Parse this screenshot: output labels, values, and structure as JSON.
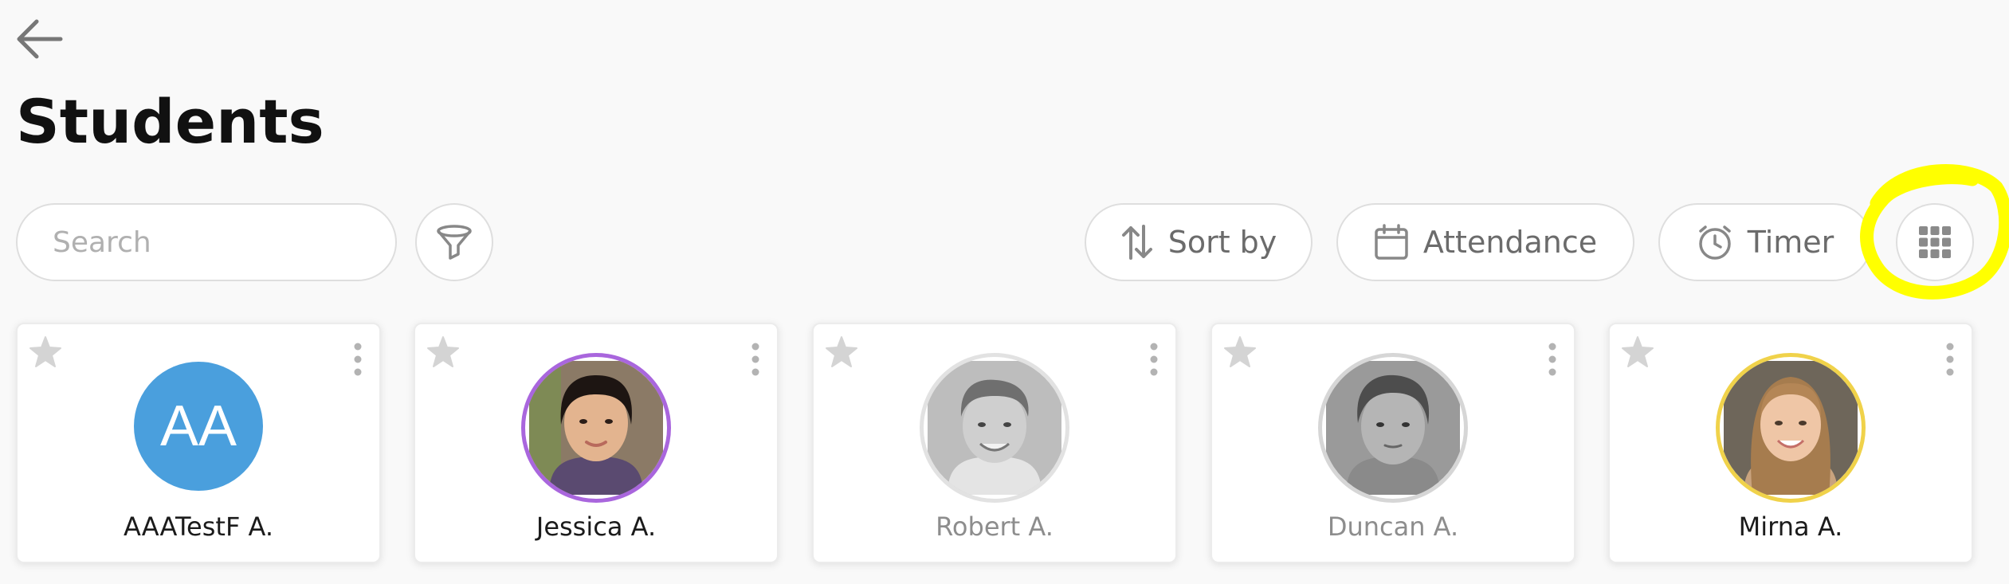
{
  "header": {
    "back_icon": "arrow-left-icon",
    "title": "Students"
  },
  "toolbar": {
    "search_placeholder": "Search",
    "filter_icon": "funnel-icon",
    "sort_label": "Sort by",
    "attendance_label": "Attendance",
    "timer_label": "Timer",
    "grid_icon": "grid-view-icon"
  },
  "colors": {
    "highlight": "#ffff00",
    "initials_avatar": "#4a9fdd",
    "ring_purple": "#a966dd",
    "ring_gold": "#f0d24a",
    "ring_gray": "#d6d6d6"
  },
  "students": [
    {
      "name": "AAATestF A.",
      "initials": "AA"
    },
    {
      "name": "Jessica A."
    },
    {
      "name": "Robert A."
    },
    {
      "name": "Duncan A."
    },
    {
      "name": "Mirna A."
    }
  ]
}
